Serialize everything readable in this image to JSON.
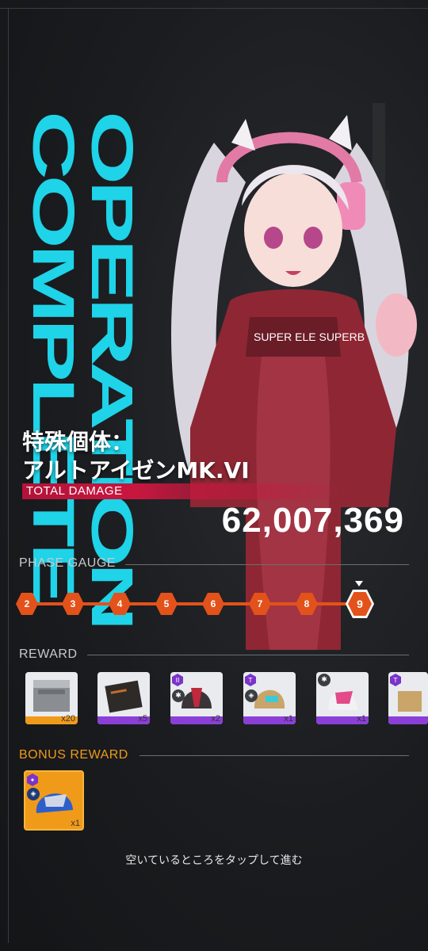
{
  "operation_text": "OPERATION COMPLETE",
  "boss": {
    "line1": "特殊個体：",
    "line2": "アルトアイゼンMK.VI"
  },
  "total_damage": {
    "label": "TOTAL DAMAGE",
    "value": "62,007,369"
  },
  "phase_gauge": {
    "label": "PHASE GAUGE",
    "phases": [
      "2",
      "3",
      "4",
      "5",
      "6",
      "7",
      "8",
      "9"
    ],
    "current": "9"
  },
  "reward": {
    "label": "REWARD",
    "items": [
      {
        "name": "supply-box",
        "count": "x20",
        "band": "#f09a1a"
      },
      {
        "name": "document-case",
        "count": "x5",
        "band": "#8b3fd6"
      },
      {
        "name": "helmet-red",
        "count": "x2",
        "band": "#8b3fd6",
        "badge": "II"
      },
      {
        "name": "helmet-gold",
        "count": "x1",
        "band": "#8b3fd6",
        "badge": "T"
      },
      {
        "name": "helmet-pink",
        "count": "x1",
        "band": "#8b3fd6"
      },
      {
        "name": "helmet-partial",
        "count": "",
        "band": "#8b3fd6",
        "badge": "T"
      }
    ]
  },
  "bonus_reward": {
    "label": "BONUS REWARD",
    "item": {
      "name": "helmet-blue",
      "count": "x1"
    }
  },
  "tap_hint": "空いているところをタップして進む",
  "colors": {
    "accent": "#e3521a",
    "cyan": "#1fd3e8",
    "damage_bar": "#c8173f",
    "purple": "#8b3fd6",
    "gold": "#f09a1a"
  }
}
